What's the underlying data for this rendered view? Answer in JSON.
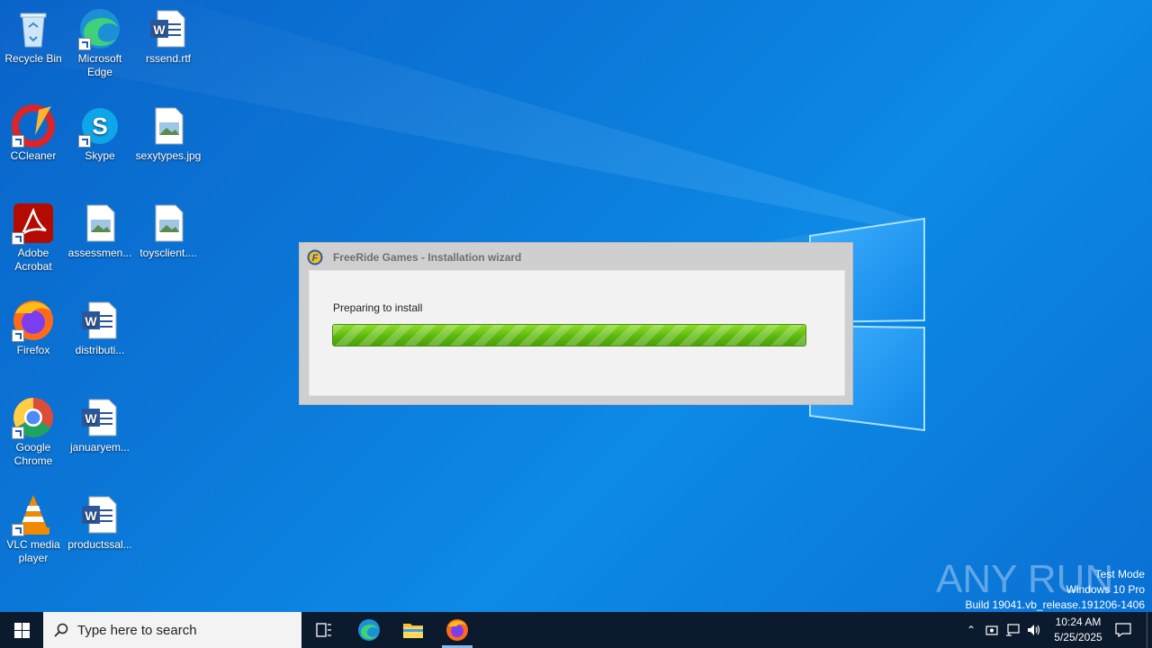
{
  "desktop": {
    "icons": [
      {
        "label": "Recycle Bin"
      },
      {
        "label": "Microsoft Edge"
      },
      {
        "label": "rssend.rtf"
      },
      {
        "label": "CCleaner"
      },
      {
        "label": "Skype"
      },
      {
        "label": "sexytypes.jpg"
      },
      {
        "label": "Adobe Acrobat"
      },
      {
        "label": "assessmen..."
      },
      {
        "label": "toysclient...."
      },
      {
        "label": "Firefox"
      },
      {
        "label": "distributi..."
      },
      {
        "label": "Google Chrome"
      },
      {
        "label": "januaryem..."
      },
      {
        "label": "VLC media player"
      },
      {
        "label": "productssal..."
      }
    ]
  },
  "dialog": {
    "title": "FreeRide Games - Installation wizard",
    "status": "Preparing to install",
    "progress": 1.0,
    "accent": "#5cb80e"
  },
  "watermark": {
    "line1": "Test Mode",
    "line2": "Windows 10 Pro",
    "line3": "Build 19041.vb_release.191206-1406",
    "brand": "ANY RUN"
  },
  "taskbar": {
    "search_placeholder": "Type here to search",
    "time": "10:24 AM",
    "date": "5/25/2025",
    "background": "#0b1a2d"
  }
}
